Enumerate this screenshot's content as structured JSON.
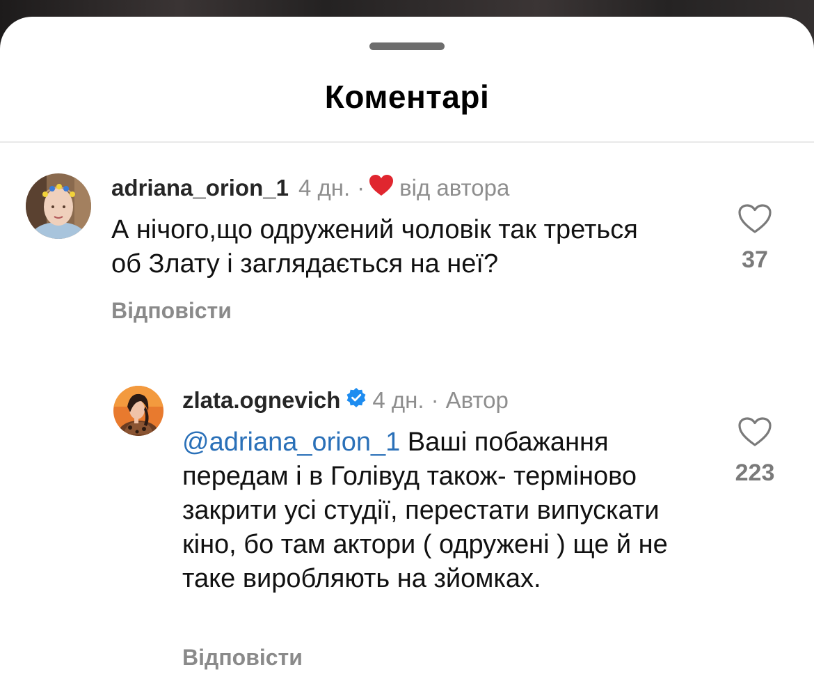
{
  "sheet": {
    "title": "Коментарі"
  },
  "comments": [
    {
      "username": "adriana_orion_1",
      "time": "4 дн.",
      "separator": "·",
      "badge_text": "від автора",
      "badge_icon": "red-heart-icon",
      "text": "А нічого,що одружений чоловік так треться об Злату і заглядається на неї?",
      "reply_label": "Відповісти",
      "like_count": "37",
      "like_icon": "heart-outline-icon"
    }
  ],
  "replies": [
    {
      "username": "zlata.ognevich",
      "verified_icon": "verified-badge-icon",
      "time": "4 дн.",
      "separator": "·",
      "author_label": "Автор",
      "mention": "@adriana_orion_1",
      "text": " Ваші побажання передам і в Голівуд також- терміново закрити усі студії, перестати випускати кіно, бо там актори ( одружені ) ще й не таке виробляють на зйомках.",
      "reply_label": "Відповісти",
      "like_count": "223",
      "like_icon": "heart-outline-icon"
    }
  ],
  "colors": {
    "accent_mention": "#2a70b8",
    "heart_red": "#e0262f",
    "verified_blue": "#1d8cf0"
  }
}
